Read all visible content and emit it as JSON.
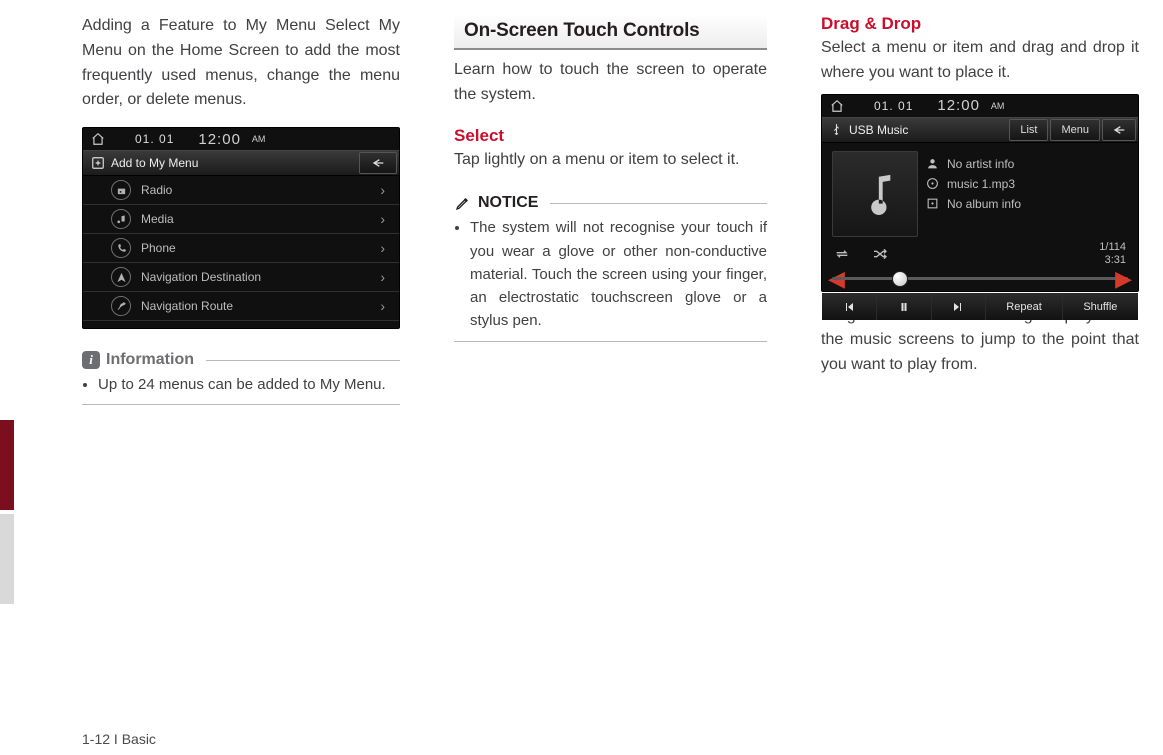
{
  "footer": "1-12 I Basic",
  "col1": {
    "intro": "Adding a Feature to My Menu Select My Menu on the Home Screen to add the most frequently used menus, change the menu order, or delete menus.",
    "info_label": "Information",
    "info_bullet": "Up to 24 menus can be added to My Menu."
  },
  "shot1": {
    "date": "01. 01",
    "time": "12:00",
    "ampm": "AM",
    "title": "Add to My Menu",
    "rows": [
      {
        "label": "Radio"
      },
      {
        "label": "Media"
      },
      {
        "label": "Phone"
      },
      {
        "label": "Navigation Destination"
      },
      {
        "label": "Navigation Route"
      }
    ]
  },
  "col2": {
    "heading": "On-Screen Touch Controls",
    "intro": "Learn how to touch the screen to operate the system.",
    "select_title": "Select",
    "select_body": "Tap lightly on a menu or item to select it.",
    "notice_label": "NOTICE",
    "notice_bullet": "The system will not recognise your touch if you wear a glove or other non-conductive material. Touch the screen using your finger, an electrostatic touchscreen glove or a stylus pen."
  },
  "col3": {
    "drag_title": "Drag & Drop",
    "drag_body": "Select a menu or item and drag and drop it where you want to place it.",
    "caption": "Drag or touch the slider along the play bar in the music screens to jump to the point that you want to play from."
  },
  "shot2": {
    "date": "01. 01",
    "time": "12:00",
    "ampm": "AM",
    "title": "USB Music",
    "btn_list": "List",
    "btn_menu": "Menu",
    "artist": "No artist info",
    "track": "music 1.mp3",
    "album": "No album info",
    "count": "1/114",
    "elapsed": "3:31",
    "repeat": "Repeat",
    "shuffle": "Shuffle"
  }
}
